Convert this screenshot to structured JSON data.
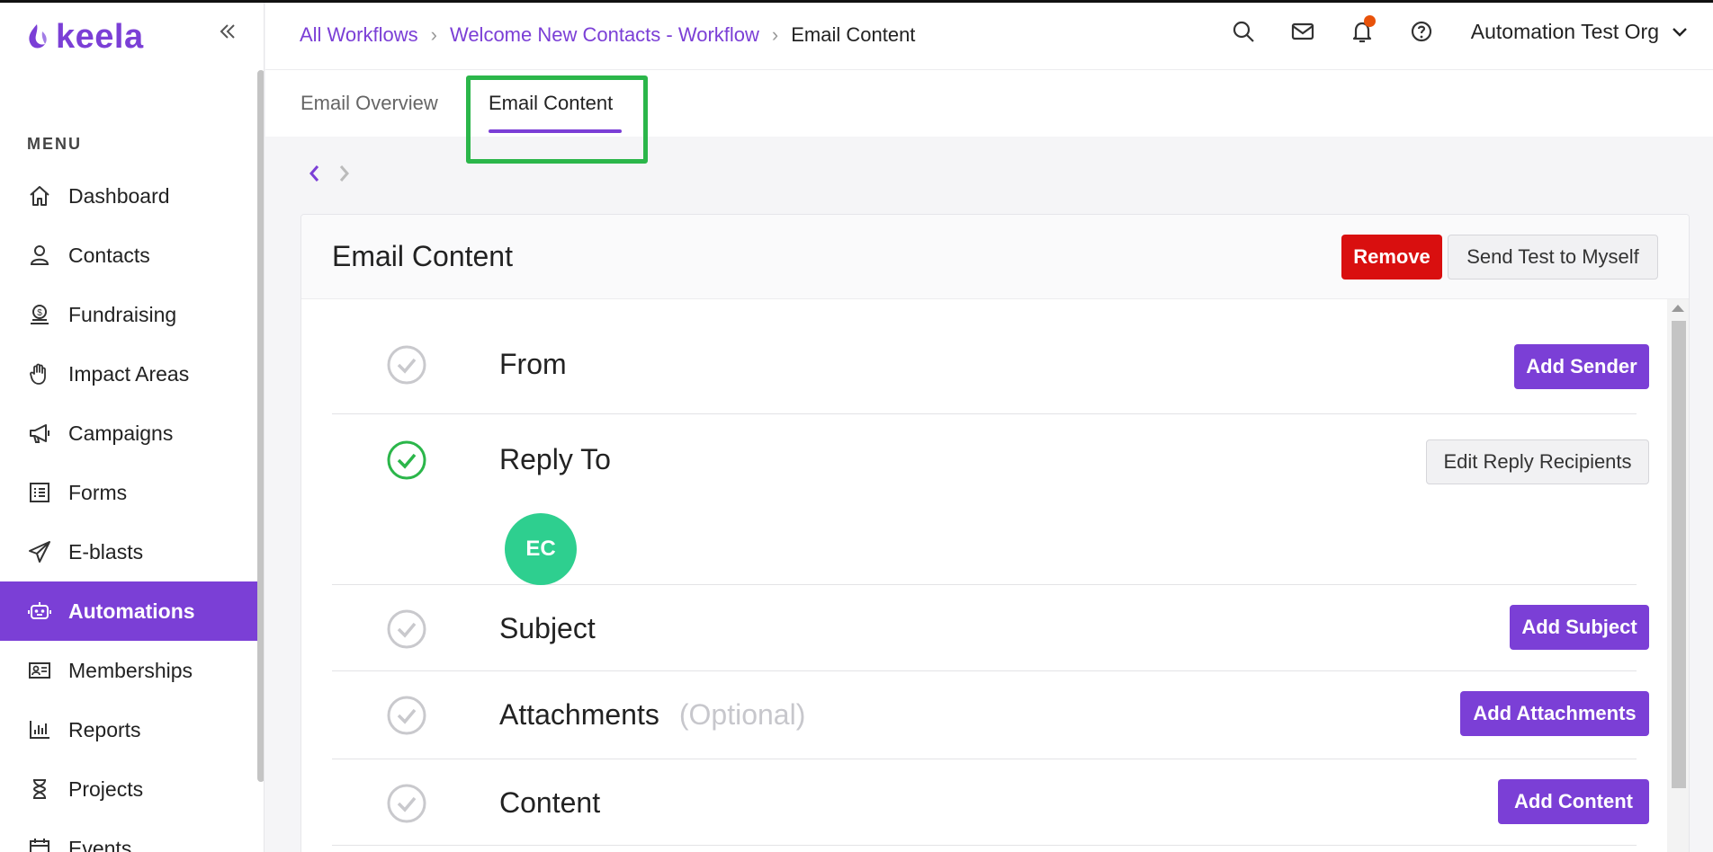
{
  "brand": {
    "name": "keela",
    "color": "#7b3fd6"
  },
  "sidebar": {
    "menu_heading": "MENU",
    "items": [
      {
        "label": "Dashboard",
        "icon": "home-icon"
      },
      {
        "label": "Contacts",
        "icon": "user-icon"
      },
      {
        "label": "Fundraising",
        "icon": "donation-icon"
      },
      {
        "label": "Impact Areas",
        "icon": "hand-heart-icon"
      },
      {
        "label": "Campaigns",
        "icon": "megaphone-icon"
      },
      {
        "label": "Forms",
        "icon": "list-form-icon"
      },
      {
        "label": "E-blasts",
        "icon": "paper-plane-icon"
      },
      {
        "label": "Automations",
        "icon": "robot-icon",
        "active": true
      },
      {
        "label": "Memberships",
        "icon": "id-card-icon"
      },
      {
        "label": "Reports",
        "icon": "bar-chart-icon"
      },
      {
        "label": "Projects",
        "icon": "hourglass-icon"
      },
      {
        "label": "Events",
        "icon": "calendar-icon"
      }
    ]
  },
  "header": {
    "breadcrumb": {
      "items": [
        "All Workflows",
        "Welcome New Contacts - Workflow"
      ],
      "current": "Email Content"
    },
    "org_name": "Automation Test Org",
    "icons": [
      "search-icon",
      "mail-icon",
      "bell-icon",
      "help-icon"
    ],
    "notification_color": "#e8520a"
  },
  "tabs": [
    {
      "label": "Email Overview",
      "active": false
    },
    {
      "label": "Email Content",
      "active": true
    }
  ],
  "card": {
    "title": "Email Content",
    "remove_label": "Remove",
    "send_test_label": "Send Test to Myself",
    "sections": [
      {
        "label": "From",
        "complete": false,
        "action": "Add Sender"
      },
      {
        "label": "Reply To",
        "complete": true,
        "action": "Edit Reply Recipients",
        "avatar": "EC"
      },
      {
        "label": "Subject",
        "complete": false,
        "action": "Add Subject"
      },
      {
        "label": "Attachments",
        "optional": "(Optional)",
        "complete": false,
        "action": "Add Attachments"
      },
      {
        "label": "Content",
        "complete": false,
        "action": "Add Content"
      }
    ]
  },
  "colors": {
    "accent": "#7b3fd6",
    "danger": "#d90f0f",
    "success": "#2bb64a",
    "avatar": "#2ecf8f",
    "highlight": "#2bb64a"
  }
}
